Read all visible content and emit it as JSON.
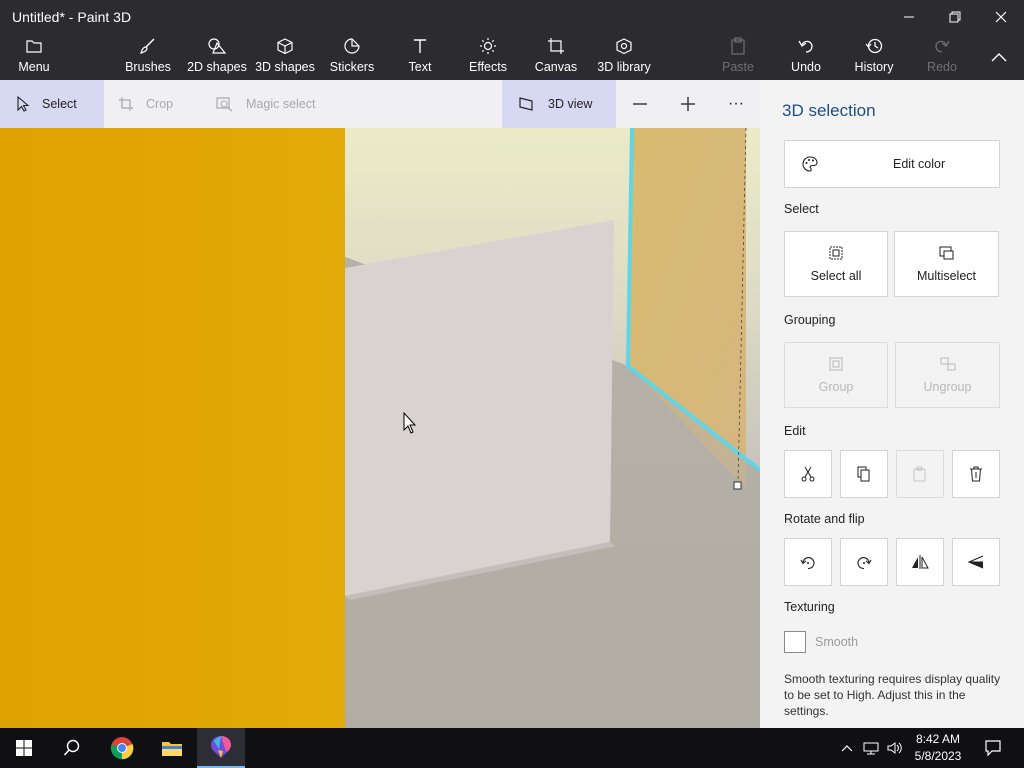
{
  "window": {
    "title": "Untitled* - Paint 3D"
  },
  "ribbon": {
    "menu": "Menu",
    "items": [
      {
        "label": "Brushes",
        "icon": "brush-icon"
      },
      {
        "label": "2D shapes",
        "icon": "shapes-2d-icon"
      },
      {
        "label": "3D shapes",
        "icon": "cube-icon"
      },
      {
        "label": "Stickers",
        "icon": "sticker-icon"
      },
      {
        "label": "Text",
        "icon": "text-icon"
      },
      {
        "label": "Effects",
        "icon": "sun-icon"
      },
      {
        "label": "Canvas",
        "icon": "canvas-icon"
      },
      {
        "label": "3D library",
        "icon": "library-icon"
      }
    ],
    "paste": "Paste",
    "undo": "Undo",
    "history": "History",
    "redo": "Redo"
  },
  "toolbar": {
    "select": "Select",
    "crop": "Crop",
    "magic_select": "Magic select",
    "view_3d": "3D view",
    "more": "···"
  },
  "panel": {
    "title": "3D selection",
    "edit_color": "Edit color",
    "select_heading": "Select",
    "select_all": "Select all",
    "multiselect": "Multiselect",
    "grouping_heading": "Grouping",
    "group": "Group",
    "ungroup": "Ungroup",
    "edit_heading": "Edit",
    "rotate_heading": "Rotate and flip",
    "texturing_heading": "Texturing",
    "smooth": "Smooth",
    "note": "Smooth texturing requires display quality to be set to High. Adjust this in the settings."
  },
  "taskbar": {
    "time": "8:42 AM",
    "date": "5/8/2023"
  },
  "colors": {
    "titlebar": "#2b2b30",
    "accent": "#1d4e89",
    "selection": "#5fd6e8",
    "yellow_wall": "#e0a500"
  }
}
